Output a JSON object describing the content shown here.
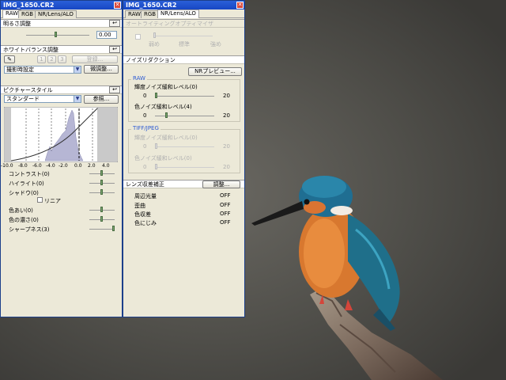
{
  "left_window": {
    "title": "IMG_1650.CR2",
    "tabs": [
      "RAW",
      "RGB",
      "NR/Lens/ALO"
    ],
    "brightness": {
      "header": "明るさ調整",
      "value": "0.00"
    },
    "white_balance": {
      "header": "ホワイトバランス調整",
      "numbered_buttons": [
        "1",
        "2",
        "3"
      ],
      "register_label": "登録...",
      "preset_value": "撮影時設定",
      "fine_tune_label": "微調整..."
    },
    "picture_style": {
      "header": "ピクチャースタイル",
      "style_value": "スタンダード",
      "browse_label": "参照...",
      "histogram_ticks": [
        "-10.0",
        "-8.0",
        "-6.0",
        "-4.0",
        "-2.0",
        "0.0",
        "2.0",
        "4.0"
      ],
      "sliders": [
        {
          "label": "コントラスト(0)",
          "value": 0
        },
        {
          "label": "ハイライト(0)",
          "value": 0
        },
        {
          "label": "シャドウ(0)",
          "value": 0
        }
      ],
      "linear_label": "リニア",
      "sliders2": [
        {
          "label": "色あい(0)",
          "value": 0
        },
        {
          "label": "色の濃さ(0)",
          "value": 0
        },
        {
          "label": "シャープネス(3)",
          "value": 3
        }
      ]
    }
  },
  "right_window": {
    "title": "IMG_1650.CR2",
    "tabs": [
      "RAW",
      "RGB",
      "NR/Lens/ALO"
    ],
    "alo": {
      "header": "オートライティングオプティマイザ",
      "ticks": [
        "弱め",
        "標準",
        "強め"
      ]
    },
    "noise_reduction": {
      "header": "ノイズリダクション",
      "preview_label": "NRプレビュー...",
      "raw_group": "RAW",
      "raw_sliders": [
        {
          "label": "輝度ノイズ緩和レベル(0)",
          "min": "0",
          "max": "20"
        },
        {
          "label": "色ノイズ緩和レベル(4)",
          "min": "0",
          "max": "20"
        }
      ],
      "tiff_group": "TIFF/JPEG",
      "tiff_sliders": [
        {
          "label": "輝度ノイズ緩和レベル(0)",
          "min": "0",
          "max": "20"
        },
        {
          "label": "色ノイズ緩和レベル(0)",
          "min": "0",
          "max": "20"
        }
      ]
    },
    "lens": {
      "header": "レンズ収差補正",
      "adjust_label": "調整...",
      "items": [
        {
          "label": "周辺光量",
          "state": "OFF"
        },
        {
          "label": "歪曲",
          "state": "OFF"
        },
        {
          "label": "色収差",
          "state": "OFF"
        },
        {
          "label": "色にじみ",
          "state": "OFF"
        }
      ]
    }
  },
  "colors": {
    "titlebar": "#2a5fd8",
    "panel": "#ece9d8",
    "section_blue": "#2c5ad3"
  }
}
